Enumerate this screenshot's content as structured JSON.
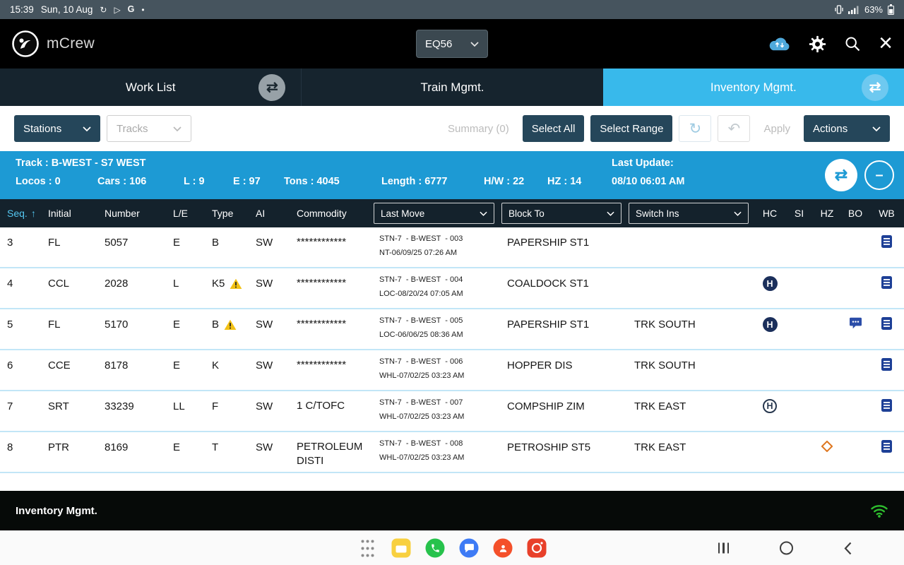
{
  "accent_colors": {
    "active_tab_blue": "#38B9EB",
    "info_bar_blue": "#1D9AD4",
    "table_header_navy": "#14222C",
    "button_navy": "#25465A",
    "warning_yellow": "#F2C114",
    "hazmat_badge_navy": "#1B2F5B",
    "doc_icon_blue": "#1D3F96",
    "hazmat_diamond_orange": "#DE761E",
    "wifi_green": "#2EBD2E"
  },
  "status_bar": {
    "time": "15:39",
    "date": "Sun, 10 Aug",
    "battery_percent": "63%"
  },
  "header": {
    "app_name": "mCrew",
    "train_selector_value": "EQ56"
  },
  "tabs": [
    {
      "label": "Work List"
    },
    {
      "label": "Train Mgmt."
    },
    {
      "label": "Inventory Mgmt."
    }
  ],
  "toolbar": {
    "stations": "Stations",
    "tracks": "Tracks",
    "summary": "Summary (0)",
    "select_all": "Select All",
    "select_range": "Select Range",
    "apply": "Apply",
    "actions": "Actions"
  },
  "track_info": {
    "track": "Track : B-WEST - S7 WEST",
    "locos": "Locos : 0",
    "cars": "Cars : 106",
    "loads": "L : 9",
    "empties": "E : 97",
    "tons": "Tons : 4045",
    "length": "Length : 6777",
    "hw": "H/W : 22",
    "hz": "HZ : 14",
    "last_update_label": "Last Update:",
    "last_update_value": "08/10 06:01 AM"
  },
  "table": {
    "headers": {
      "seq": "Seq.",
      "initial": "Initial",
      "number": "Number",
      "le": "L/E",
      "type": "Type",
      "ai": "AI",
      "commodity": "Commodity",
      "last_move": "Last Move",
      "block_to": "Block To",
      "switch_ins": "Switch Ins",
      "hc": "HC",
      "si": "SI",
      "hz": "HZ",
      "bo": "BO",
      "wb": "WB"
    },
    "rows": [
      {
        "seq": "3",
        "initial": "FL",
        "number": "5057",
        "le": "E",
        "type": "B",
        "type_warning": false,
        "ai": "SW",
        "commodity": "************",
        "last_move_line1": "STN-7  - B-WEST  - 003",
        "last_move_line2": "NT-06/09/25 07:26 AM",
        "block_to": "PAPERSHIP ST1",
        "switch_ins": "",
        "hc_icon": "",
        "si_icon": "",
        "hz_icon": "",
        "bo_icon": "",
        "wb_icon": "equipment-doc"
      },
      {
        "seq": "4",
        "initial": "CCL",
        "number": "2028",
        "le": "L",
        "type": "K5",
        "type_warning": true,
        "ai": "SW",
        "commodity": "************",
        "last_move_line1": "STN-7  - B-WEST  - 004",
        "last_move_line2": "LOC-08/20/24 07:05 AM",
        "block_to": "COALDOCK ST1",
        "switch_ins": "",
        "hc_icon": "hazmat-h-filled",
        "si_icon": "",
        "hz_icon": "",
        "bo_icon": "",
        "wb_icon": "equipment-doc"
      },
      {
        "seq": "5",
        "initial": "FL",
        "number": "5170",
        "le": "E",
        "type": "B",
        "type_warning": true,
        "ai": "SW",
        "commodity": "************",
        "last_move_line1": "STN-7  - B-WEST  - 005",
        "last_move_line2": "LOC-06/06/25 08:36 AM",
        "block_to": "PAPERSHIP ST1",
        "switch_ins": "TRK SOUTH",
        "hc_icon": "hazmat-h-filled",
        "si_icon": "",
        "hz_icon": "",
        "bo_icon": "chat-bubble",
        "wb_icon": "equipment-doc"
      },
      {
        "seq": "6",
        "initial": "CCE",
        "number": "8178",
        "le": "E",
        "type": "K",
        "type_warning": false,
        "ai": "SW",
        "commodity": "************",
        "last_move_line1": "STN-7  - B-WEST  - 006",
        "last_move_line2": "WHL-07/02/25 03:23 AM",
        "block_to": "HOPPER DIS",
        "switch_ins": "TRK SOUTH",
        "hc_icon": "",
        "si_icon": "",
        "hz_icon": "",
        "bo_icon": "",
        "wb_icon": "equipment-doc"
      },
      {
        "seq": "7",
        "initial": "SRT",
        "number": "33239",
        "le": "LL",
        "type": "F",
        "type_warning": false,
        "ai": "SW",
        "commodity": "1 C/TOFC",
        "last_move_line1": "STN-7  - B-WEST  - 007",
        "last_move_line2": "WHL-07/02/25 03:23 AM",
        "block_to": "COMPSHIP ZIM",
        "switch_ins": "TRK EAST",
        "hc_icon": "hazmat-h-outline",
        "si_icon": "",
        "hz_icon": "",
        "bo_icon": "",
        "wb_icon": "equipment-doc"
      },
      {
        "seq": "8",
        "initial": "PTR",
        "number": "8169",
        "le": "E",
        "type": "T",
        "type_warning": false,
        "ai": "SW",
        "commodity": "PETROLEUM DISTI",
        "last_move_line1": "STN-7  - B-WEST  - 008",
        "last_move_line2": "WHL-07/02/25 03:23 AM",
        "block_to": "PETROSHIP ST5",
        "switch_ins": "TRK EAST",
        "hc_icon": "",
        "si_icon": "",
        "hz_icon": "hazmat-diamond",
        "bo_icon": "",
        "wb_icon": "equipment-doc"
      }
    ]
  },
  "footer": {
    "title": "Inventory Mgmt."
  }
}
